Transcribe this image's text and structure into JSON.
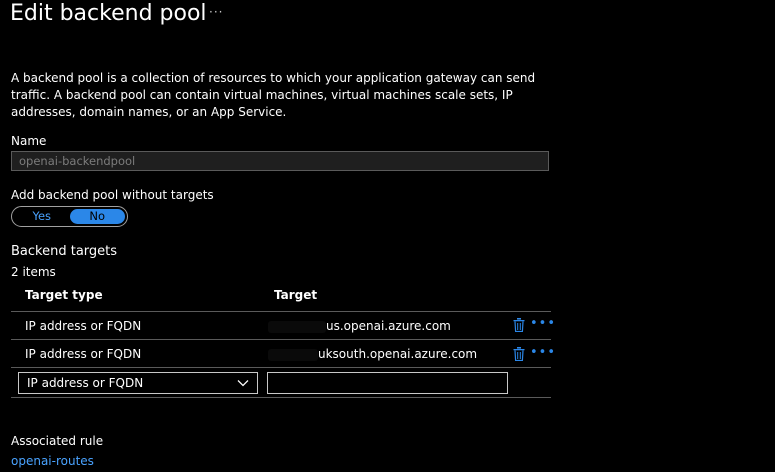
{
  "header": {
    "title": "Edit backend pool",
    "more_label": "···"
  },
  "description": "A backend pool is a collection of resources to which your application gateway can send traffic. A backend pool can contain virtual machines, virtual machines scale sets, IP addresses, domain names, or an App Service.",
  "name_field": {
    "label": "Name",
    "value": "openai-backendpool"
  },
  "without_targets": {
    "label": "Add backend pool without targets",
    "options": [
      "Yes",
      "No"
    ],
    "selected": "No"
  },
  "backend_targets": {
    "title": "Backend targets",
    "count": "2 items",
    "columns": [
      "Target type",
      "Target"
    ],
    "rows": [
      {
        "type": "IP address or FQDN",
        "target_prefix": "xxxxxxxx",
        "target_suffix": "us.openai.azure.com"
      },
      {
        "type": "IP address or FQDN",
        "target_prefix": "xxxxxxxxxx",
        "target_suffix": "uksouth.openai.azure.com"
      }
    ],
    "new_row": {
      "type": "IP address or FQDN",
      "target_placeholder": ""
    },
    "row_more_label": "•••"
  },
  "associated_rule": {
    "label": "Associated rule",
    "link": "openai-routes"
  },
  "colors": {
    "background": "#000000",
    "accent": "#2b87e8",
    "link": "#4aa3ff",
    "divider": "#5a5a5a"
  }
}
